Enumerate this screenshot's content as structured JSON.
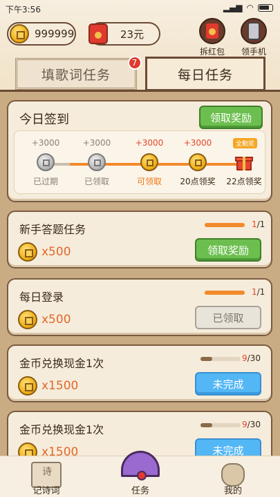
{
  "status": {
    "time": "下午3:56",
    "signal": "▂▄▆",
    "wifi": "◠",
    "battery": ""
  },
  "currency": {
    "coins": "999999",
    "cash": "23元"
  },
  "top_buttons": [
    {
      "label": "拆红包",
      "icon": "red-packet-icon"
    },
    {
      "label": "领手机",
      "icon": "phone-icon"
    }
  ],
  "tabs": [
    {
      "label": "填歌词任务",
      "badge": "7",
      "active": false
    },
    {
      "label": "每日任务",
      "active": true
    }
  ],
  "signin": {
    "title": "今日签到",
    "button": "领取奖励",
    "bonus_tag": "全勤奖",
    "steps": [
      {
        "amount": "+3000",
        "label": "已过期",
        "state": "expired"
      },
      {
        "amount": "+3000",
        "label": "已领取",
        "state": "claimed"
      },
      {
        "amount": "+3000",
        "label": "可领取",
        "state": "available"
      },
      {
        "amount": "+3000",
        "label": "20点领奖",
        "state": "upcoming"
      },
      {
        "amount": "",
        "label": "22点领奖",
        "state": "gift"
      }
    ]
  },
  "tasks": [
    {
      "title": "新手答题任务",
      "reward": "x500",
      "progress_text_cur": "1",
      "progress_text_total": "/1",
      "progress": 1.0,
      "button": "领取奖励",
      "button_style": "green"
    },
    {
      "title": "每日登录",
      "reward": "x500",
      "progress_text_cur": "1",
      "progress_text_total": "/1",
      "progress": 1.0,
      "button": "已领取",
      "button_style": "gray"
    },
    {
      "title": "金币兑换现金1次",
      "reward": "x1500",
      "progress_text_cur": "9",
      "progress_text_total": "/30",
      "progress": 0.3,
      "button": "未完成",
      "button_style": "blue"
    },
    {
      "title": "金币兑换现金1次",
      "reward": "x1500",
      "progress_text_cur": "9",
      "progress_text_total": "/30",
      "progress": 0.3,
      "button": "未完成",
      "button_style": "blue"
    }
  ],
  "nav": [
    {
      "label": "记诗词",
      "icon": "poem-book-icon"
    },
    {
      "label": "任务",
      "icon": "fan-icon",
      "active": true
    },
    {
      "label": "我的",
      "icon": "bag-icon"
    }
  ]
}
